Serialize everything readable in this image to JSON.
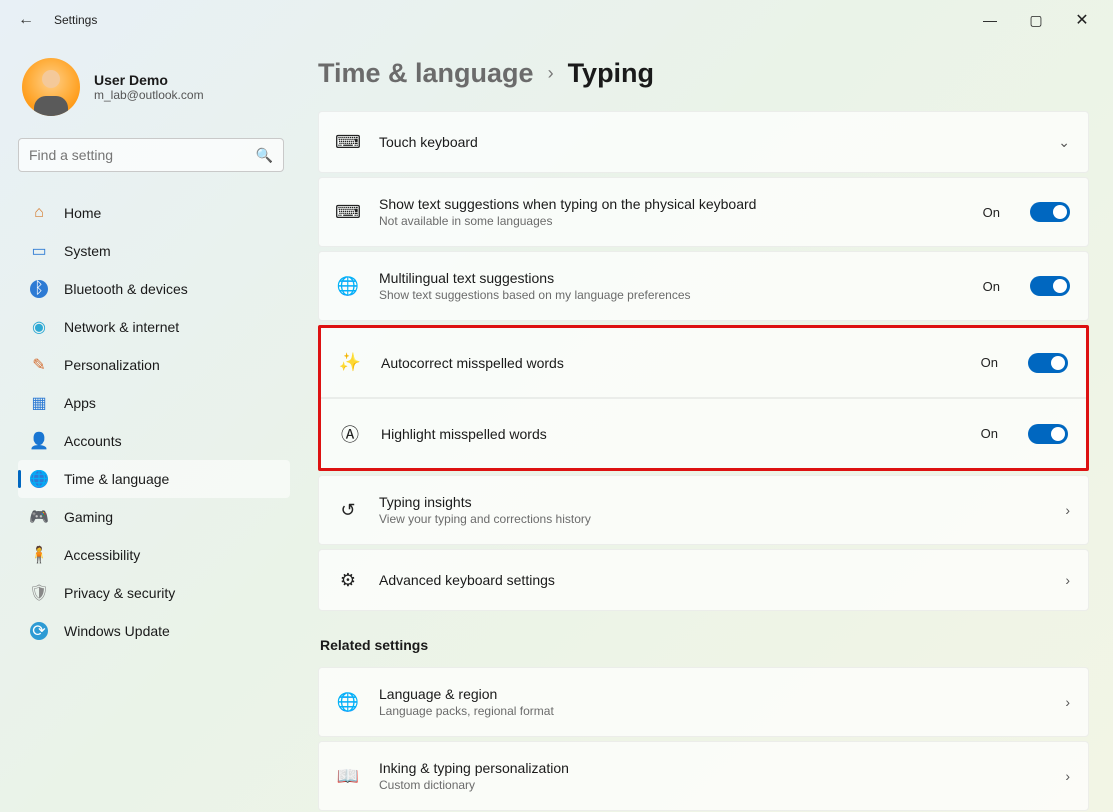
{
  "window": {
    "title": "Settings"
  },
  "user": {
    "name": "User Demo",
    "email": "m_lab@outlook.com"
  },
  "search": {
    "placeholder": "Find a setting"
  },
  "nav": [
    {
      "label": "Home"
    },
    {
      "label": "System"
    },
    {
      "label": "Bluetooth & devices"
    },
    {
      "label": "Network & internet"
    },
    {
      "label": "Personalization"
    },
    {
      "label": "Apps"
    },
    {
      "label": "Accounts"
    },
    {
      "label": "Time & language"
    },
    {
      "label": "Gaming"
    },
    {
      "label": "Accessibility"
    },
    {
      "label": "Privacy & security"
    },
    {
      "label": "Windows Update"
    }
  ],
  "breadcrumb": {
    "parent": "Time & language",
    "current": "Typing"
  },
  "cards": {
    "touch": {
      "title": "Touch keyboard"
    },
    "phys": {
      "title": "Show text suggestions when typing on the physical keyboard",
      "sub": "Not available in some languages",
      "state": "On"
    },
    "multi": {
      "title": "Multilingual text suggestions",
      "sub": "Show text suggestions based on my language preferences",
      "state": "On"
    },
    "auto": {
      "title": "Autocorrect misspelled words",
      "state": "On"
    },
    "highlight": {
      "title": "Highlight misspelled words",
      "state": "On"
    },
    "insights": {
      "title": "Typing insights",
      "sub": "View your typing and corrections history"
    },
    "advanced": {
      "title": "Advanced keyboard settings"
    }
  },
  "related": {
    "heading": "Related settings",
    "lang": {
      "title": "Language & region",
      "sub": "Language packs, regional format"
    },
    "ink": {
      "title": "Inking & typing personalization",
      "sub": "Custom dictionary"
    }
  }
}
